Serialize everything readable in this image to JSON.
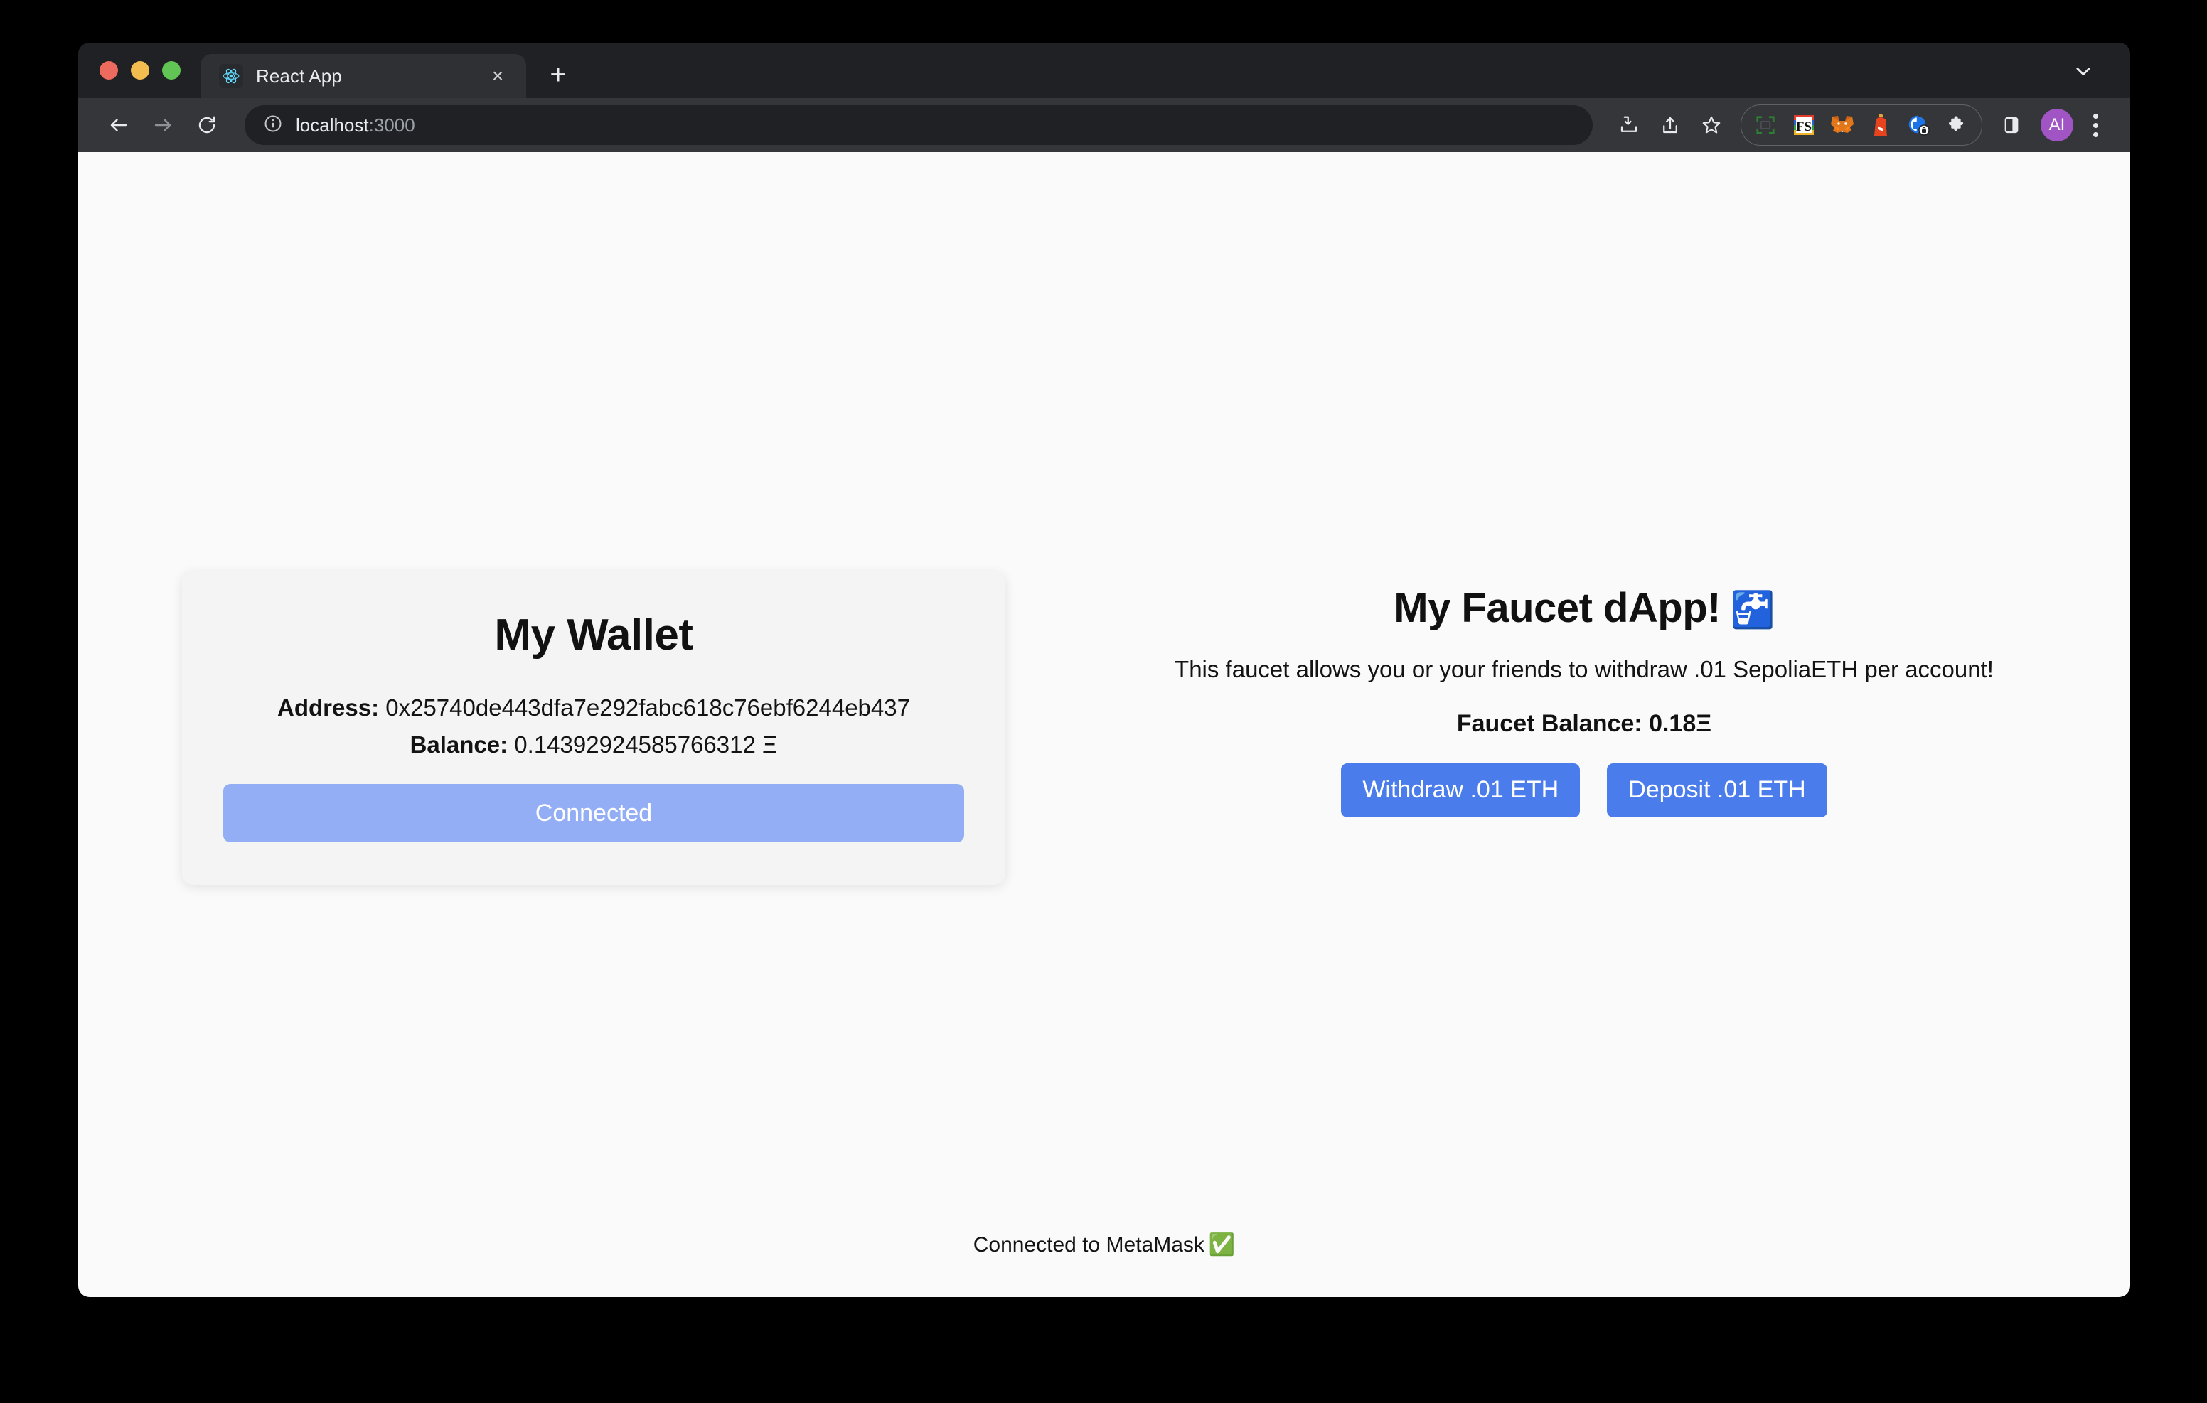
{
  "window": {
    "traffic_lights": [
      "close",
      "minimize",
      "zoom"
    ]
  },
  "tab_strip": {
    "tab_title": "React App",
    "favicon_name": "react-logo-icon",
    "close_label": "×",
    "new_tab_label": "+",
    "tab_search_name": "chevron-down-icon"
  },
  "toolbar": {
    "back_name": "back-arrow-icon",
    "forward_name": "forward-arrow-icon",
    "reload_name": "reload-icon",
    "site_info_name": "info-circle-icon",
    "url_main": "localhost",
    "url_port": ":3000",
    "url_full": "localhost:3000",
    "icons_right": [
      {
        "name": "install-download-icon",
        "label": ""
      },
      {
        "name": "share-icon",
        "label": ""
      },
      {
        "name": "bookmark-star-icon",
        "label": ""
      }
    ],
    "extensions": [
      {
        "name": "screenshot-capture-icon",
        "label": ""
      },
      {
        "name": "fs-extension-icon",
        "label": "FS"
      },
      {
        "name": "metamask-fox-icon",
        "label": ""
      },
      {
        "name": "lighthouse-icon",
        "label": ""
      },
      {
        "name": "privacy-lock-icon",
        "label": ""
      },
      {
        "name": "extensions-puzzle-icon",
        "label": ""
      }
    ],
    "side_panel_name": "side-panel-icon",
    "profile_initials": "AI",
    "menu_name": "three-dot-menu-icon"
  },
  "page": {
    "background": "#fafafa",
    "wallet": {
      "title": "My Wallet",
      "address_label": "Address:",
      "address_value": "0x25740de443dfa7e292fabc618c76ebf6244eb437",
      "balance_label": "Balance:",
      "balance_value": "0.14392924585766312 Ξ",
      "connect_button": "Connected",
      "connect_button_color": "#93aef5",
      "card_background": "#f4f4f4"
    },
    "faucet": {
      "title": "My Faucet dApp!",
      "title_emoji": "🚰",
      "description": "This faucet allows you or your friends to withdraw .01 SepoliaETH per account!",
      "balance_text": "Faucet Balance: 0.18Ξ",
      "withdraw_button": "Withdraw .01 ETH",
      "deposit_button": "Deposit .01 ETH",
      "button_color": "#4a7ceb"
    },
    "footer": {
      "status_text": "Connected to MetaMask",
      "status_emoji": "✅"
    }
  }
}
